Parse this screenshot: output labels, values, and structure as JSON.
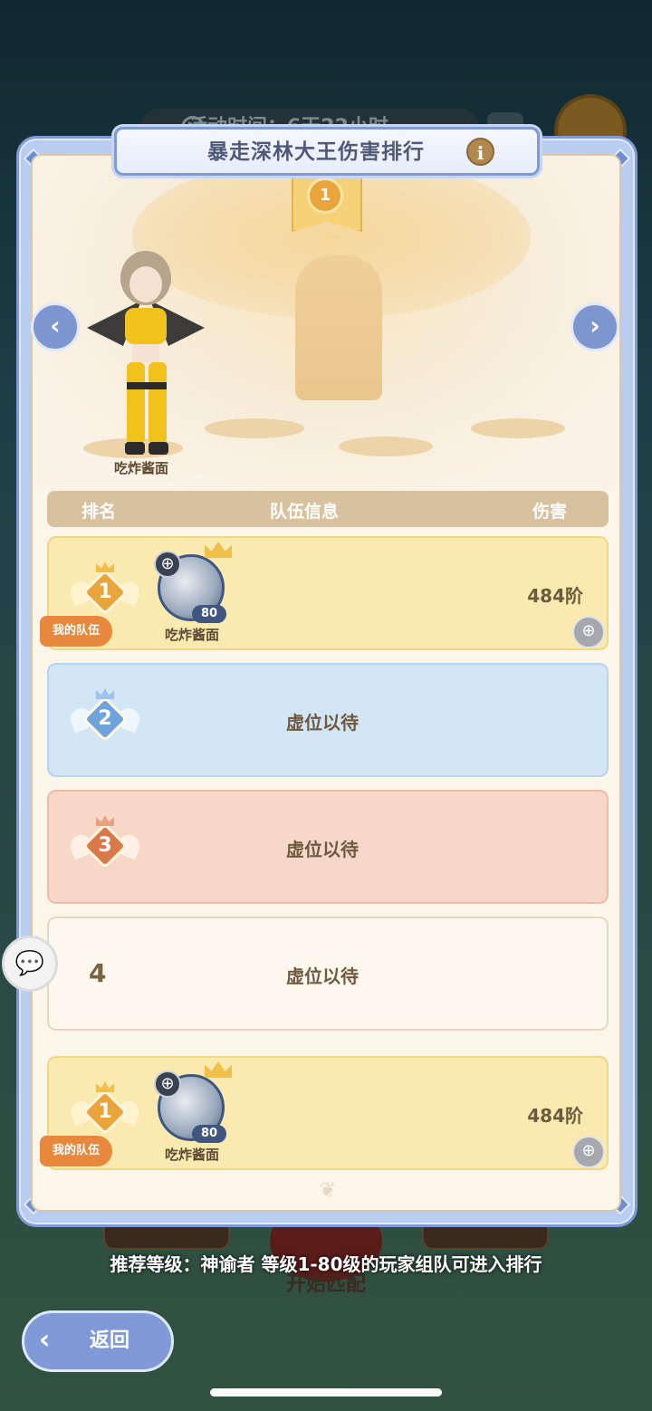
{
  "background": {
    "timer_text": "活动时间：6天22小时",
    "match_label": "开始匹配"
  },
  "panel": {
    "title": "暴走深林大王伤害排行",
    "info_icon": "i",
    "scene": {
      "top_rank_badge": "1",
      "character_name": "吃炸酱面",
      "prev_arrow": "‹",
      "next_arrow": "›"
    },
    "table": {
      "headers": {
        "rank": "排名",
        "team": "队伍信息",
        "damage": "伤害"
      },
      "rows": [
        {
          "rank": "1",
          "my_team_tag": "我的队伍",
          "member_name": "吃炸酱面",
          "level": "80",
          "damage": "484阶",
          "style": "gold"
        },
        {
          "rank": "2",
          "vacant": "虚位以待",
          "style": "blue"
        },
        {
          "rank": "3",
          "vacant": "虚位以待",
          "style": "peach"
        },
        {
          "rank": "4",
          "vacant": "虚位以待",
          "style": "cream"
        }
      ],
      "my_row": {
        "rank": "1",
        "my_team_tag": "我的队伍",
        "member_name": "吃炸酱面",
        "level": "80",
        "damage": "484阶"
      }
    }
  },
  "recommend_text": "推荐等级：神谕者  等级1-80级的玩家组队可进入排行",
  "back_button": {
    "label": "返回",
    "icon": "back-arrow-icon"
  },
  "colors": {
    "panel_blue": "#7f9ad6",
    "gold_row": "#fbeaaf",
    "blue_row": "#d3e6f6",
    "peach_row": "#f7d7c7",
    "my_team_tag": "#e7883d"
  }
}
